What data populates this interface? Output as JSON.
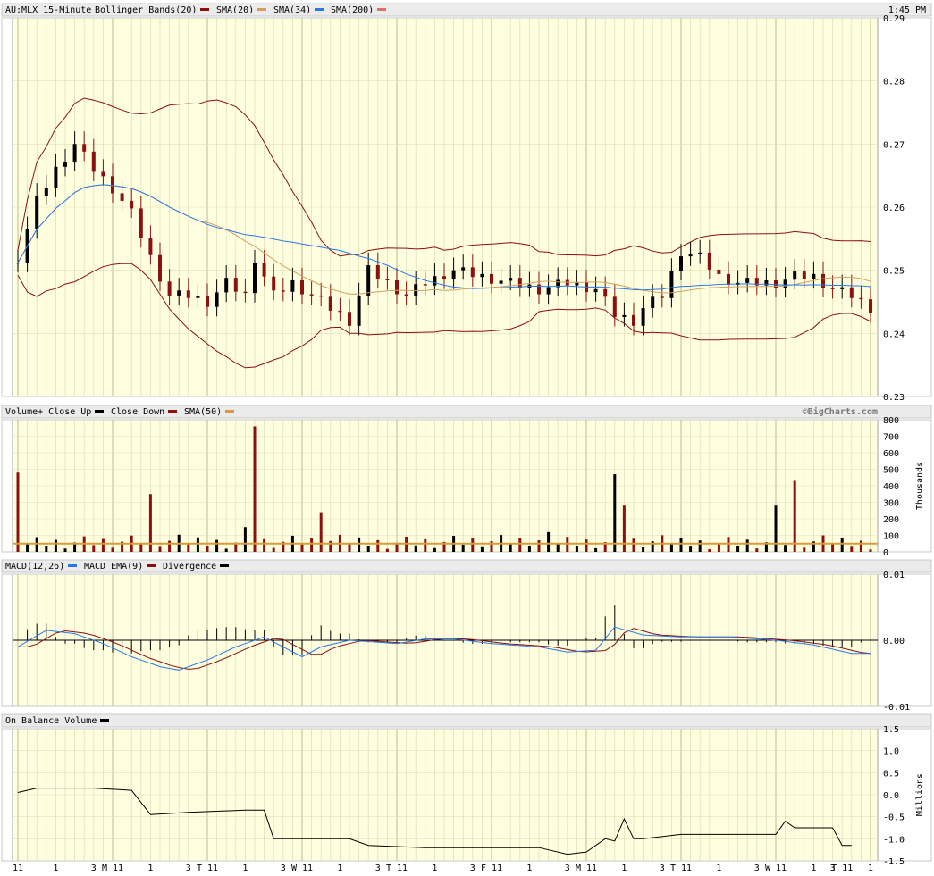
{
  "chart_data": [
    {
      "type": "candlestick",
      "header": {
        "symbol": "AU:MLX 15-Minute",
        "time": "1:45 PM",
        "legend": [
          {
            "label": "Bollinger Bands(20)",
            "color": "#8b1010"
          },
          {
            "label": "SMA(20)",
            "color": "#d0a060"
          },
          {
            "label": "SMA(34)",
            "color": "#2a7ae2"
          },
          {
            "label": "SMA(200)",
            "color": "#e07070"
          }
        ]
      },
      "ylim": [
        0.23,
        0.29
      ],
      "yticks": [
        "0.29",
        "0.28",
        "0.27",
        "0.26",
        "0.25",
        "0.24",
        "0.23"
      ],
      "price_path": [
        [
          0,
          0.252
        ],
        [
          2,
          0.261
        ],
        [
          4,
          0.266
        ],
        [
          6,
          0.27
        ],
        [
          8,
          0.266
        ],
        [
          10,
          0.263
        ],
        [
          12,
          0.259
        ],
        [
          14,
          0.252
        ],
        [
          16,
          0.246
        ],
        [
          18,
          0.246
        ],
        [
          20,
          0.245
        ],
        [
          22,
          0.248
        ],
        [
          24,
          0.246
        ],
        [
          25,
          0.252
        ],
        [
          26,
          0.249
        ],
        [
          27,
          0.246
        ],
        [
          29,
          0.248
        ],
        [
          31,
          0.246
        ],
        [
          33,
          0.244
        ],
        [
          35,
          0.242
        ],
        [
          37,
          0.25
        ],
        [
          39,
          0.248
        ],
        [
          41,
          0.246
        ],
        [
          43,
          0.248
        ],
        [
          46,
          0.25
        ],
        [
          49,
          0.249
        ],
        [
          52,
          0.248
        ],
        [
          55,
          0.247
        ],
        [
          58,
          0.248
        ],
        [
          61,
          0.247
        ],
        [
          63,
          0.243
        ],
        [
          65,
          0.242
        ],
        [
          66,
          0.244
        ],
        [
          68,
          0.246
        ],
        [
          70,
          0.253
        ],
        [
          72,
          0.252
        ],
        [
          74,
          0.249
        ],
        [
          76,
          0.248
        ],
        [
          78,
          0.248
        ],
        [
          80,
          0.248
        ],
        [
          82,
          0.249
        ],
        [
          84,
          0.249
        ],
        [
          86,
          0.247
        ],
        [
          88,
          0.246
        ],
        [
          90,
          0.244
        ]
      ]
    },
    {
      "type": "bar",
      "header": {
        "legend": [
          {
            "label": "Volume+ Close Up",
            "color": "#000000"
          },
          {
            "label": "Close Down",
            "color": "#8b1010"
          },
          {
            "label": "SMA(50)",
            "color": "#d89a3a"
          }
        ],
        "watermark": "©BigCharts.com"
      },
      "ylim": [
        0,
        800
      ],
      "yticks": [
        "800",
        "700",
        "600",
        "500",
        "400",
        "300",
        "200",
        "100",
        "0"
      ],
      "ylabel": "Thousands",
      "spikes": [
        [
          0,
          480,
          "down"
        ],
        [
          14,
          350,
          "down"
        ],
        [
          24,
          150,
          "up"
        ],
        [
          25,
          760,
          "down"
        ],
        [
          32,
          240,
          "down"
        ],
        [
          56,
          120,
          "up"
        ],
        [
          63,
          470,
          "up"
        ],
        [
          64,
          280,
          "down"
        ],
        [
          80,
          280,
          "up"
        ],
        [
          82,
          430,
          "down"
        ]
      ],
      "sma": 50
    },
    {
      "type": "line",
      "header": {
        "legend": [
          {
            "label": "MACD(12,26)",
            "color": "#2a7ae2"
          },
          {
            "label": "MACD EMA(9)",
            "color": "#8b1010"
          },
          {
            "label": "Divergence",
            "color": "#000000"
          }
        ]
      },
      "ylim": [
        -0.01,
        0.01
      ],
      "yticks": [
        "0.01",
        "0.00",
        "-0.01"
      ],
      "macd_path": [
        [
          0,
          -0.001
        ],
        [
          3,
          0.0015
        ],
        [
          6,
          0.001
        ],
        [
          9,
          -0.0005
        ],
        [
          12,
          -0.0025
        ],
        [
          15,
          -0.004
        ],
        [
          17,
          -0.0045
        ],
        [
          20,
          -0.003
        ],
        [
          23,
          -0.001
        ],
        [
          26,
          0.0005
        ],
        [
          28,
          -0.001
        ],
        [
          30,
          -0.0025
        ],
        [
          32,
          -0.001
        ],
        [
          35,
          0.0
        ],
        [
          40,
          -0.0005
        ],
        [
          43,
          0.0002
        ],
        [
          46,
          0.0002
        ],
        [
          50,
          -0.0005
        ],
        [
          55,
          -0.001
        ],
        [
          58,
          -0.0018
        ],
        [
          61,
          -0.0015
        ],
        [
          63,
          0.002
        ],
        [
          66,
          0.0008
        ],
        [
          70,
          0.0005
        ],
        [
          75,
          0.0005
        ],
        [
          80,
          0.0
        ],
        [
          84,
          -0.0007
        ],
        [
          88,
          -0.002
        ]
      ]
    },
    {
      "type": "line",
      "header": {
        "legend": [
          {
            "label": "On Balance Volume",
            "color": "#000000"
          }
        ]
      },
      "ylim": [
        -1.5,
        1.5
      ],
      "yticks": [
        "1.5",
        "1.0",
        "0.5",
        "0.0",
        "-0.5",
        "-1.0",
        "-1.5"
      ],
      "ylabel": "Millions",
      "obv_path": [
        [
          0,
          0.05
        ],
        [
          2,
          0.15
        ],
        [
          8,
          0.15
        ],
        [
          12,
          0.1
        ],
        [
          14,
          -0.45
        ],
        [
          18,
          -0.4
        ],
        [
          24,
          -0.35
        ],
        [
          26,
          -0.35
        ],
        [
          27,
          -1.0
        ],
        [
          35,
          -1.0
        ],
        [
          37,
          -1.15
        ],
        [
          43,
          -1.2
        ],
        [
          55,
          -1.2
        ],
        [
          58,
          -1.35
        ],
        [
          60,
          -1.3
        ],
        [
          62,
          -1.0
        ],
        [
          63,
          -1.05
        ],
        [
          64,
          -0.55
        ],
        [
          65,
          -1.0
        ],
        [
          66,
          -1.0
        ],
        [
          70,
          -0.9
        ],
        [
          80,
          -0.9
        ],
        [
          81,
          -0.6
        ],
        [
          82,
          -0.75
        ],
        [
          86,
          -0.75
        ],
        [
          87,
          -1.15
        ],
        [
          88,
          -1.15
        ]
      ]
    }
  ],
  "xaxis": {
    "ticks": [
      {
        "label": "11",
        "bar": 0
      },
      {
        "label": "1",
        "bar": 4
      },
      {
        "label": "3",
        "bar": 8
      },
      {
        "label": "M 11",
        "bar": 10
      },
      {
        "label": "1",
        "bar": 14
      },
      {
        "label": "3",
        "bar": 18
      },
      {
        "label": "T 11",
        "bar": 20
      },
      {
        "label": "1",
        "bar": 24
      },
      {
        "label": "3",
        "bar": 28
      },
      {
        "label": "W 11",
        "bar": 30
      },
      {
        "label": "1",
        "bar": 34
      },
      {
        "label": "3",
        "bar": 38
      },
      {
        "label": "T 11",
        "bar": 40
      },
      {
        "label": "1",
        "bar": 44
      },
      {
        "label": "3",
        "bar": 48
      },
      {
        "label": "F 11",
        "bar": 50
      },
      {
        "label": "1",
        "bar": 54
      },
      {
        "label": "3",
        "bar": 58
      },
      {
        "label": "M 11",
        "bar": 60
      },
      {
        "label": "1",
        "bar": 64
      },
      {
        "label": "3",
        "bar": 68
      },
      {
        "label": "T 11",
        "bar": 70
      },
      {
        "label": "1",
        "bar": 74
      },
      {
        "label": "3",
        "bar": 78
      },
      {
        "label": "W 11",
        "bar": 80
      },
      {
        "label": "1",
        "bar": 84
      },
      {
        "label": "3",
        "bar": 86
      },
      {
        "label": "T 11",
        "bar": 87
      },
      {
        "label": "1",
        "bar": 90
      }
    ]
  },
  "colors": {
    "panel_bg": "#ffffe0",
    "header_bg": "#ebebeb",
    "grid_minor": "#e0e0b8",
    "grid_major": "#c8c89a",
    "up": "#000000",
    "down": "#8b1010",
    "band": "#8b1010",
    "sma20": "#d0a060",
    "sma34": "#2a7ae2",
    "vol_sma": "#d89a3a",
    "macd": "#2a7ae2",
    "macd_ema": "#8b1010"
  }
}
